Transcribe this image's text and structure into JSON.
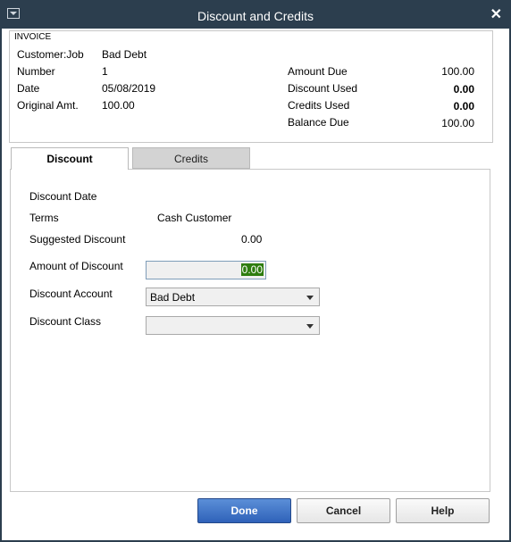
{
  "window": {
    "title": "Discount and Credits"
  },
  "invoice": {
    "heading": "INVOICE",
    "customer_label": "Customer:Job",
    "customer_value": "Bad Debt",
    "number_label": "Number",
    "number_value": "1",
    "date_label": "Date",
    "date_value": "05/08/2019",
    "original_label": "Original Amt.",
    "original_value": "100.00",
    "amount_due_label": "Amount Due",
    "amount_due_value": "100.00",
    "discount_used_label": "Discount Used",
    "discount_used_value": "0.00",
    "credits_used_label": "Credits Used",
    "credits_used_value": "0.00",
    "balance_due_label": "Balance Due",
    "balance_due_value": "100.00"
  },
  "tabs": {
    "discount": "Discount",
    "credits": "Credits"
  },
  "discount": {
    "date_label": "Discount Date",
    "terms_label": "Terms",
    "terms_value": "Cash Customer",
    "suggested_label": "Suggested Discount",
    "suggested_value": "0.00",
    "amount_label": "Amount of Discount",
    "amount_value": "0.00",
    "account_label": "Discount Account",
    "account_value": "Bad Debt",
    "class_label": "Discount Class",
    "class_value": ""
  },
  "buttons": {
    "done": "Done",
    "cancel": "Cancel",
    "help": "Help"
  }
}
